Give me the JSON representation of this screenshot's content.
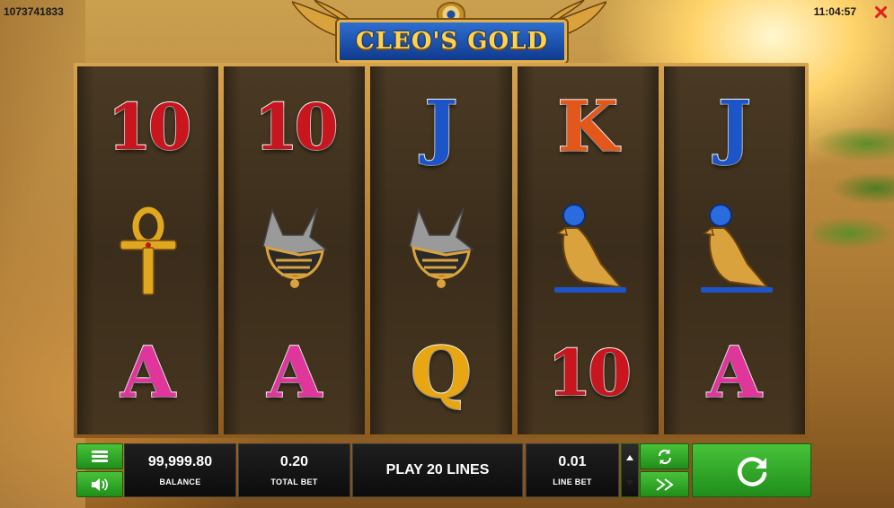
{
  "topbar": {
    "session_id": "1073741833",
    "clock": "11:04:57",
    "close_icon": "close-icon"
  },
  "logo": {
    "text": "CLEO'S GOLD",
    "emblem_icon": "eye-of-horus-icon"
  },
  "reels": [
    [
      {
        "symbol": "10",
        "kind": "letter",
        "color": "#c8151e"
      },
      {
        "symbol": "ankh",
        "kind": "picture"
      },
      {
        "symbol": "A",
        "kind": "letter",
        "color": "#e0359b"
      }
    ],
    [
      {
        "symbol": "10",
        "kind": "letter",
        "color": "#c8151e"
      },
      {
        "symbol": "anubis",
        "kind": "picture"
      },
      {
        "symbol": "A",
        "kind": "letter",
        "color": "#e0359b"
      }
    ],
    [
      {
        "symbol": "J",
        "kind": "letter",
        "color": "#1c55c8"
      },
      {
        "symbol": "anubis",
        "kind": "picture"
      },
      {
        "symbol": "Q",
        "kind": "letter",
        "color": "#e8a612"
      }
    ],
    [
      {
        "symbol": "K",
        "kind": "letter",
        "color": "#e3571a"
      },
      {
        "symbol": "horus-falcon",
        "kind": "picture"
      },
      {
        "symbol": "10",
        "kind": "letter",
        "color": "#c8151e"
      }
    ],
    [
      {
        "symbol": "J",
        "kind": "letter",
        "color": "#1c55c8"
      },
      {
        "symbol": "horus-falcon",
        "kind": "picture"
      },
      {
        "symbol": "A",
        "kind": "letter",
        "color": "#e0359b"
      }
    ]
  ],
  "controls": {
    "menu_icon": "hamburger-icon",
    "sound_icon": "speaker-icon",
    "balance_value": "99,999.80",
    "balance_label": "BALANCE",
    "total_bet_value": "0.20",
    "total_bet_label": "TOTAL BET",
    "lines_label": "PLAY 20 LINES",
    "line_bet_value": "0.01",
    "line_bet_label": "LINE BET",
    "autoplay_icon": "autoplay-icon",
    "turbo_icon": "fast-forward-icon",
    "spin_icon": "spin-icon",
    "accent_green": "#2fa326"
  }
}
